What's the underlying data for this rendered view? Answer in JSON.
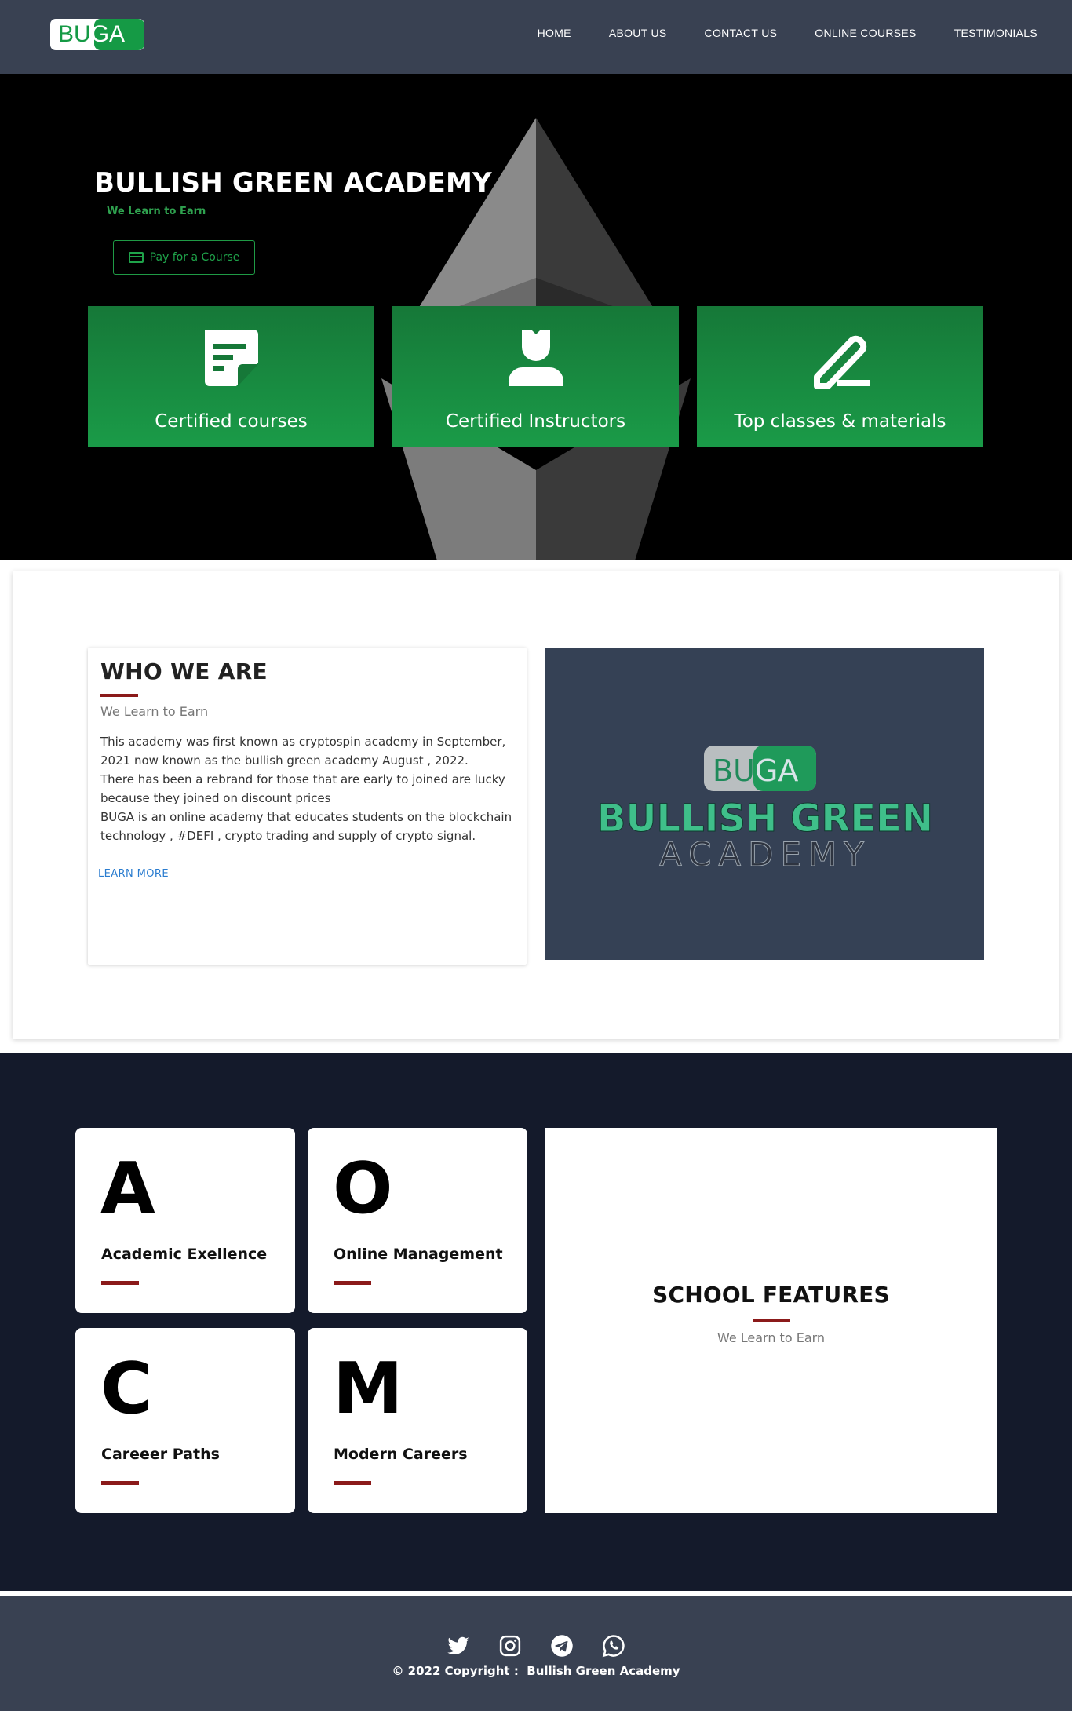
{
  "nav": {
    "logo": {
      "part1": "BU",
      "part2": "GA"
    },
    "links": [
      "HOME",
      "ABOUT US",
      "CONTACT US",
      "ONLINE COURSES",
      "TESTIMONIALS"
    ]
  },
  "hero": {
    "title": "BULLISH GREEN ACADEMY",
    "subtitle": "We Learn to Earn",
    "pay_button": "Pay for a Course",
    "features": [
      {
        "label": "Certified courses",
        "icon": "note-icon"
      },
      {
        "label": "Certified Instructors",
        "icon": "user-icon"
      },
      {
        "label": "Top classes & materials",
        "icon": "pencil-icon"
      }
    ]
  },
  "about": {
    "title": "WHO WE ARE",
    "subtitle": "We Learn to Earn",
    "paragraphs": [
      "This academy was first known as cryptospin academy in September, 2021 now known as the bullish green academy August , 2022.",
      "There has been a rebrand for those that are early to joined are lucky because they joined on discount prices",
      "BUGA is an online academy that educates students on the blockchain technology , #DEFI , crypto trading and supply of crypto signal."
    ],
    "learn_more": "LEARN MORE",
    "image": {
      "logo_part1": "BU",
      "logo_part2": "GA",
      "line1": "BULLISH GREEN",
      "line2": "ACADEMY"
    }
  },
  "features": {
    "tiles": [
      {
        "letter": "A",
        "label": "Academic Exellence"
      },
      {
        "letter": "O",
        "label": "Online Management"
      },
      {
        "letter": "C",
        "label": "Careeer Paths"
      },
      {
        "letter": "M",
        "label": "Modern Careers"
      }
    ],
    "title": "SCHOOL FEATURES",
    "subtitle": "We Learn to Earn"
  },
  "footer": {
    "socials": [
      "twitter-icon",
      "instagram-icon",
      "telegram-icon",
      "whatsapp-icon"
    ],
    "copyright_prefix": "© 2022 Copyright :",
    "copyright_name": "Bullish Green Academy"
  },
  "colors": {
    "green": "#1a9b48",
    "nav": "#394152",
    "dark": "#141a2b",
    "accent_red": "#8b1a1a"
  }
}
